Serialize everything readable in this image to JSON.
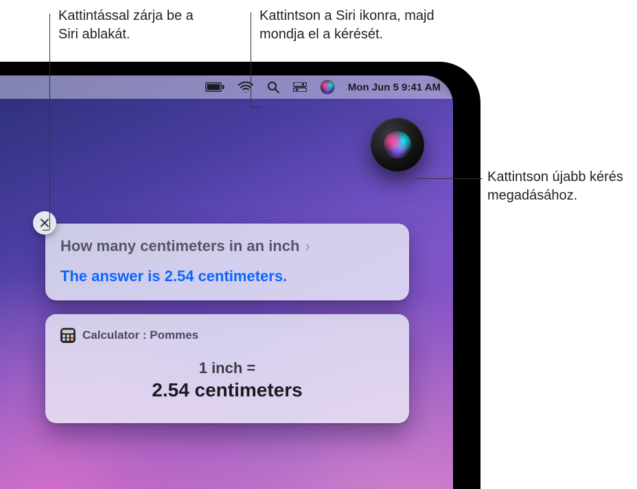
{
  "callouts": {
    "close_siri": "Kattintással zárja be a Siri ablakát.",
    "click_siri_icon": "Kattintson a Siri ikonra, majd mondja el a kérését.",
    "another_request": "Kattintson újabb kérés megadásához."
  },
  "menubar": {
    "datetime": "Mon Jun 5  9:41 AM"
  },
  "siri": {
    "question": "How many centimeters in an inch",
    "answer": "The answer is 2.54 centimeters."
  },
  "calculator": {
    "header": "Calculator : Pommes",
    "line1": "1 inch =",
    "line2": "2.54 centimeters"
  }
}
